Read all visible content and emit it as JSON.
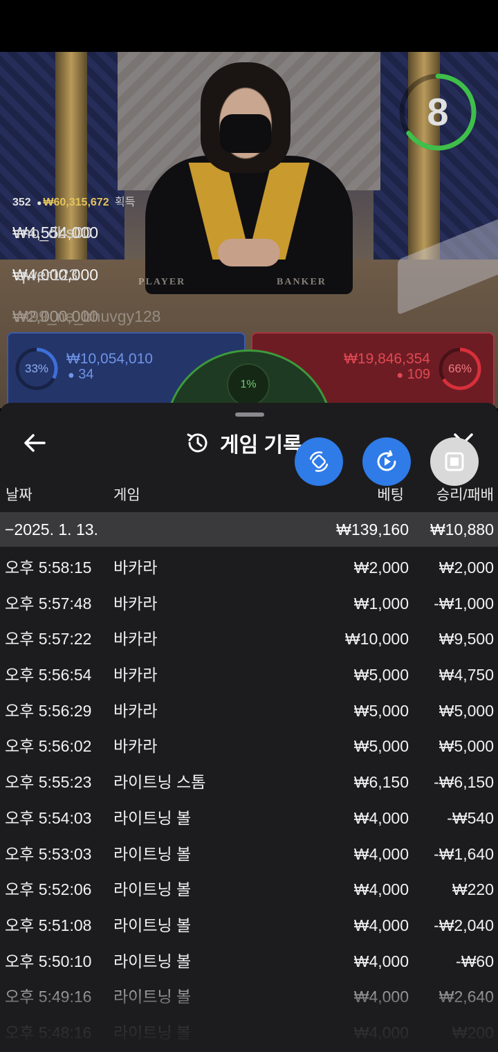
{
  "video": {
    "countdown": "8",
    "timer_fraction": 0.65,
    "table_labels": {
      "player": "PLAYER",
      "banker": "BANKER"
    },
    "winners": {
      "count": "352",
      "total": "₩60,315,672",
      "label": "획득",
      "rows": [
        {
          "amount": "₩4,554,000",
          "user": "rno_dbs00"
        },
        {
          "amount": "₩4,000,000",
          "user": "qwer123"
        },
        {
          "amount": "₩2,000,000",
          "user": "nt99_ne_bhuvgy128"
        }
      ]
    },
    "bets": {
      "player": {
        "percent": "33%",
        "fraction": 0.33,
        "amount": "₩10,054,010",
        "count": "34",
        "color": "#3d6fd8"
      },
      "banker": {
        "percent": "66%",
        "fraction": 0.66,
        "amount": "₩19,846,354",
        "count": "109",
        "color": "#d8303a"
      },
      "tie": {
        "percent": "1%",
        "color": "#3c9a3c"
      }
    }
  },
  "sheet": {
    "title": "게임 기록",
    "icons": {
      "back": "arrow-left-icon",
      "history": "history-icon",
      "close": "close-icon",
      "fab1": "rotate-icon",
      "fab2": "replay-icon",
      "fab3": "stop-icon"
    },
    "columns": {
      "date": "날짜",
      "game": "게임",
      "bet": "베팅",
      "winloss": "승리/패배"
    },
    "summary": {
      "date": "−2025. 1. 13.",
      "bet": "₩139,160",
      "winloss": "₩10,880"
    },
    "rows": [
      {
        "time": "오후 5:58:15",
        "game": "바카라",
        "bet": "₩2,000",
        "winloss": "₩2,000"
      },
      {
        "time": "오후 5:57:48",
        "game": "바카라",
        "bet": "₩1,000",
        "winloss": "-₩1,000"
      },
      {
        "time": "오후 5:57:22",
        "game": "바카라",
        "bet": "₩10,000",
        "winloss": "₩9,500"
      },
      {
        "time": "오후 5:56:54",
        "game": "바카라",
        "bet": "₩5,000",
        "winloss": "₩4,750"
      },
      {
        "time": "오후 5:56:29",
        "game": "바카라",
        "bet": "₩5,000",
        "winloss": "₩5,000"
      },
      {
        "time": "오후 5:56:02",
        "game": "바카라",
        "bet": "₩5,000",
        "winloss": "₩5,000"
      },
      {
        "time": "오후 5:55:23",
        "game": "라이트닝 스톰",
        "bet": "₩6,150",
        "winloss": "-₩6,150"
      },
      {
        "time": "오후 5:54:03",
        "game": "라이트닝 볼",
        "bet": "₩4,000",
        "winloss": "-₩540"
      },
      {
        "time": "오후 5:53:03",
        "game": "라이트닝 볼",
        "bet": "₩4,000",
        "winloss": "-₩1,640"
      },
      {
        "time": "오후 5:52:06",
        "game": "라이트닝 볼",
        "bet": "₩4,000",
        "winloss": "₩220"
      },
      {
        "time": "오후 5:51:08",
        "game": "라이트닝 볼",
        "bet": "₩4,000",
        "winloss": "-₩2,040"
      },
      {
        "time": "오후 5:50:10",
        "game": "라이트닝 볼",
        "bet": "₩4,000",
        "winloss": "-₩60"
      },
      {
        "time": "오후 5:49:16",
        "game": "라이트닝 볼",
        "bet": "₩4,000",
        "winloss": "₩2,640"
      },
      {
        "time": "오후 5:48:16",
        "game": "라이트닝 볼",
        "bet": "₩4,000",
        "winloss": "₩200"
      }
    ]
  }
}
